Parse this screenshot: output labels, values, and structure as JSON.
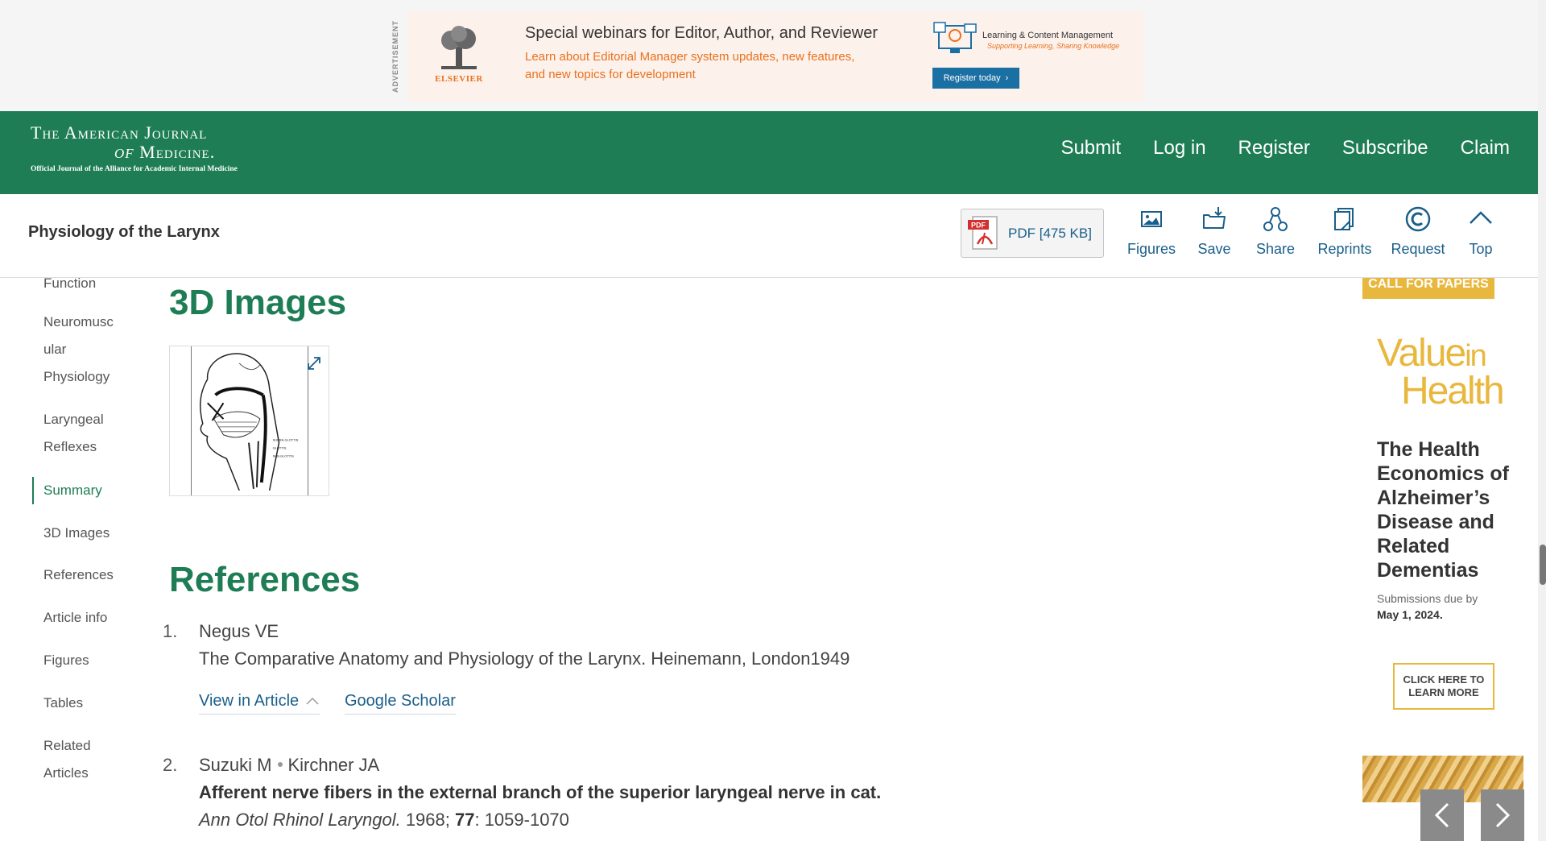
{
  "ad_banner": {
    "label": "ADVERTISEMENT",
    "brand": "ELSEVIER",
    "title": "Special webinars for Editor, Author, and Reviewer",
    "subtitle_line1": "Learn about Editorial Manager system updates, new features,",
    "subtitle_line2": "and new topics for development",
    "product_title": "Learning & Content Management",
    "product_tagline": "Supporting Learning, Sharing Knowledge",
    "cta": "Register today"
  },
  "journal": {
    "logo_line1": "The American Journal",
    "logo_of": "of",
    "logo_line2": "Medicine.",
    "tagline": "Official Journal of the Alliance for Academic Internal Medicine",
    "nav": [
      "Submit",
      "Log in",
      "Register",
      "Subscribe",
      "Claim"
    ]
  },
  "article_bar": {
    "title": "Physiology of the Larynx",
    "pdf_label": "PDF [475 KB]",
    "pdf_badge": "PDF",
    "tools": [
      {
        "label": "Figures",
        "icon": "image-icon"
      },
      {
        "label": "Save",
        "icon": "folder-save-icon"
      },
      {
        "label": "Share",
        "icon": "share-icon"
      },
      {
        "label": "Reprints",
        "icon": "reprints-icon"
      },
      {
        "label": "Request",
        "icon": "copyright-icon"
      },
      {
        "label": "Top",
        "icon": "chevron-up-icon"
      }
    ]
  },
  "sidebar": {
    "items": [
      "Function",
      "Neuromusc",
      "ular",
      "Physiology",
      "Laryngeal",
      "Reflexes",
      "Summary",
      "3D Images",
      "References",
      "Article info",
      "Figures",
      "Tables",
      "Related",
      "Articles"
    ],
    "active": "Summary"
  },
  "content": {
    "images_heading": "3D Images",
    "figure_labels": [
      "SUPRA-GLOTTIS",
      "GLOTTIS",
      "SUB-GLOTTIS"
    ],
    "references_heading": "References",
    "references": [
      {
        "num": "1.",
        "authors": "Negus VE",
        "text": "The Comparative Anatomy and Physiology of the Larynx. Heinemann, London1949",
        "links": [
          "View in Article",
          "Google Scholar"
        ]
      },
      {
        "num": "2.",
        "author_a": "Suzuki M",
        "author_b": "Kirchner JA",
        "title": "Afferent nerve fibers in the external branch of the superior laryngeal nerve in cat.",
        "journal": "Ann Otol Rhinol Laryngol.",
        "year": " 1968; ",
        "volume": "77",
        "pages": ": 1059-1070"
      }
    ]
  },
  "right_ad": {
    "tab": "CALL FOR PAPERS",
    "logo_word1": "Value",
    "logo_in": "in",
    "logo_word2": "Health",
    "headline": "The Health Economics of Alzheimer’s Disease and Related Dementias",
    "due_label": "Submissions due by",
    "due_date": "May 1, 2024.",
    "cta_line1": "CLICK HERE TO",
    "cta_line2": "LEARN MORE"
  },
  "colors": {
    "brand_green": "#1e7d55",
    "link_blue": "#1a5f8a",
    "accent_gold": "#e8b73d",
    "elsevier_orange": "#e9711c"
  }
}
